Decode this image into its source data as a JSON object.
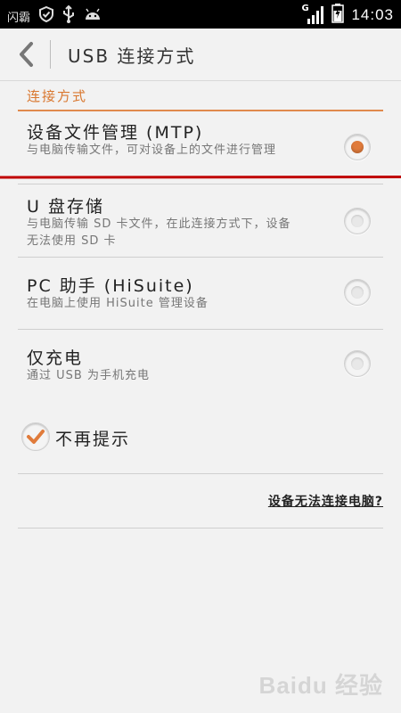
{
  "status_bar": {
    "carrier": "闪霸",
    "network": "G",
    "time": "14:03"
  },
  "header": {
    "title": "USB 连接方式"
  },
  "section": {
    "title": "连接方式"
  },
  "options": [
    {
      "title": "设备文件管理 (MTP)",
      "desc": "与电脑传输文件，可对设备上的文件进行管理",
      "selected": true
    },
    {
      "title": "U 盘存储",
      "desc": "与电脑传输 SD 卡文件，在此连接方式下，设备无法使用 SD 卡",
      "selected": false
    },
    {
      "title": "PC 助手 (HiSuite)",
      "desc": "在电脑上使用 HiSuite 管理设备",
      "selected": false
    },
    {
      "title": "仅充电",
      "desc": "通过 USB 为手机充电",
      "selected": false
    }
  ],
  "checkbox": {
    "label": "不再提示",
    "checked": true
  },
  "help_link": "设备无法连接电脑?",
  "watermark": "Baidu 经验",
  "colors": {
    "accent": "#e07b3b",
    "annotation": "#c00000",
    "background": "#f2f2f2"
  }
}
